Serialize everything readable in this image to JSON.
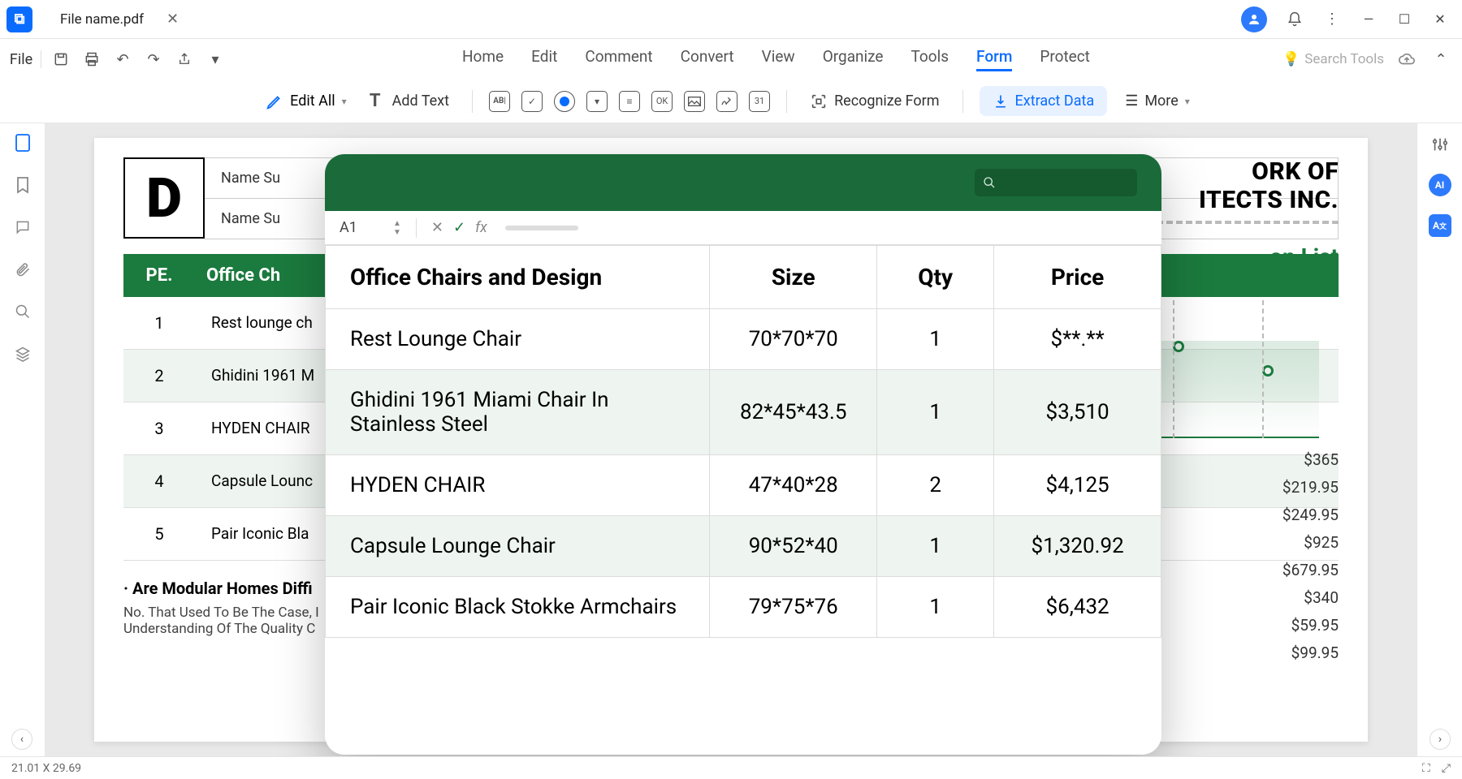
{
  "titlebar": {
    "tab_name": "File name.pdf"
  },
  "file_label": "File",
  "menu": [
    "Home",
    "Edit",
    "Comment",
    "Convert",
    "View",
    "Organize",
    "Tools",
    "Form",
    "Protect"
  ],
  "menu_active_index": 7,
  "search_placeholder": "Search Tools",
  "toolbar2": {
    "edit_all": "Edit All",
    "add_text": "Add Text",
    "recognize": "Recognize Form",
    "extract": "Extract Data",
    "more": "More"
  },
  "doc": {
    "logo": "D",
    "name_label": "Name Su",
    "title1": "ORK OF",
    "title2": "ITECTS INC.",
    "subtitle": "on List",
    "pe_label": "PE.",
    "ocd_label": "Office Ch",
    "rows": [
      {
        "n": "1",
        "t": "Rest lounge ch"
      },
      {
        "n": "2",
        "t": "Ghidini 1961 M"
      },
      {
        "n": "3",
        "t": "HYDEN CHAIR"
      },
      {
        "n": "4",
        "t": "Capsule Lounc"
      },
      {
        "n": "5",
        "t": "Pair Iconic Bla"
      }
    ],
    "para_head": "· Are Modular Homes Diffi",
    "para": "No. That Used To Be The Case, I\nUnderstanding Of The Quality C",
    "prices": [
      "$365",
      "$219.95",
      "$249.95",
      "$925",
      "$679.95",
      "$340",
      "$59.95",
      "$99.95"
    ]
  },
  "overlay": {
    "cell_ref": "A1",
    "headers": [
      "Office Chairs and Design",
      "Size",
      "Qty",
      "Price"
    ],
    "rows": [
      {
        "name": "Rest Lounge Chair",
        "size": "70*70*70",
        "qty": "1",
        "price": "$**.**"
      },
      {
        "name": "Ghidini 1961 Miami Chair In Stainless Steel",
        "size": "82*45*43.5",
        "qty": "1",
        "price": "$3,510"
      },
      {
        "name": "HYDEN CHAIR",
        "size": "47*40*28",
        "qty": "2",
        "price": "$4,125"
      },
      {
        "name": "Capsule Lounge Chair",
        "size": "90*52*40",
        "qty": "1",
        "price": "$1,320.92"
      },
      {
        "name": "Pair Iconic Black Stokke Armchairs",
        "size": "79*75*76",
        "qty": "1",
        "price": "$6,432"
      }
    ]
  },
  "status": {
    "dims": "21.01 X 29.69"
  }
}
